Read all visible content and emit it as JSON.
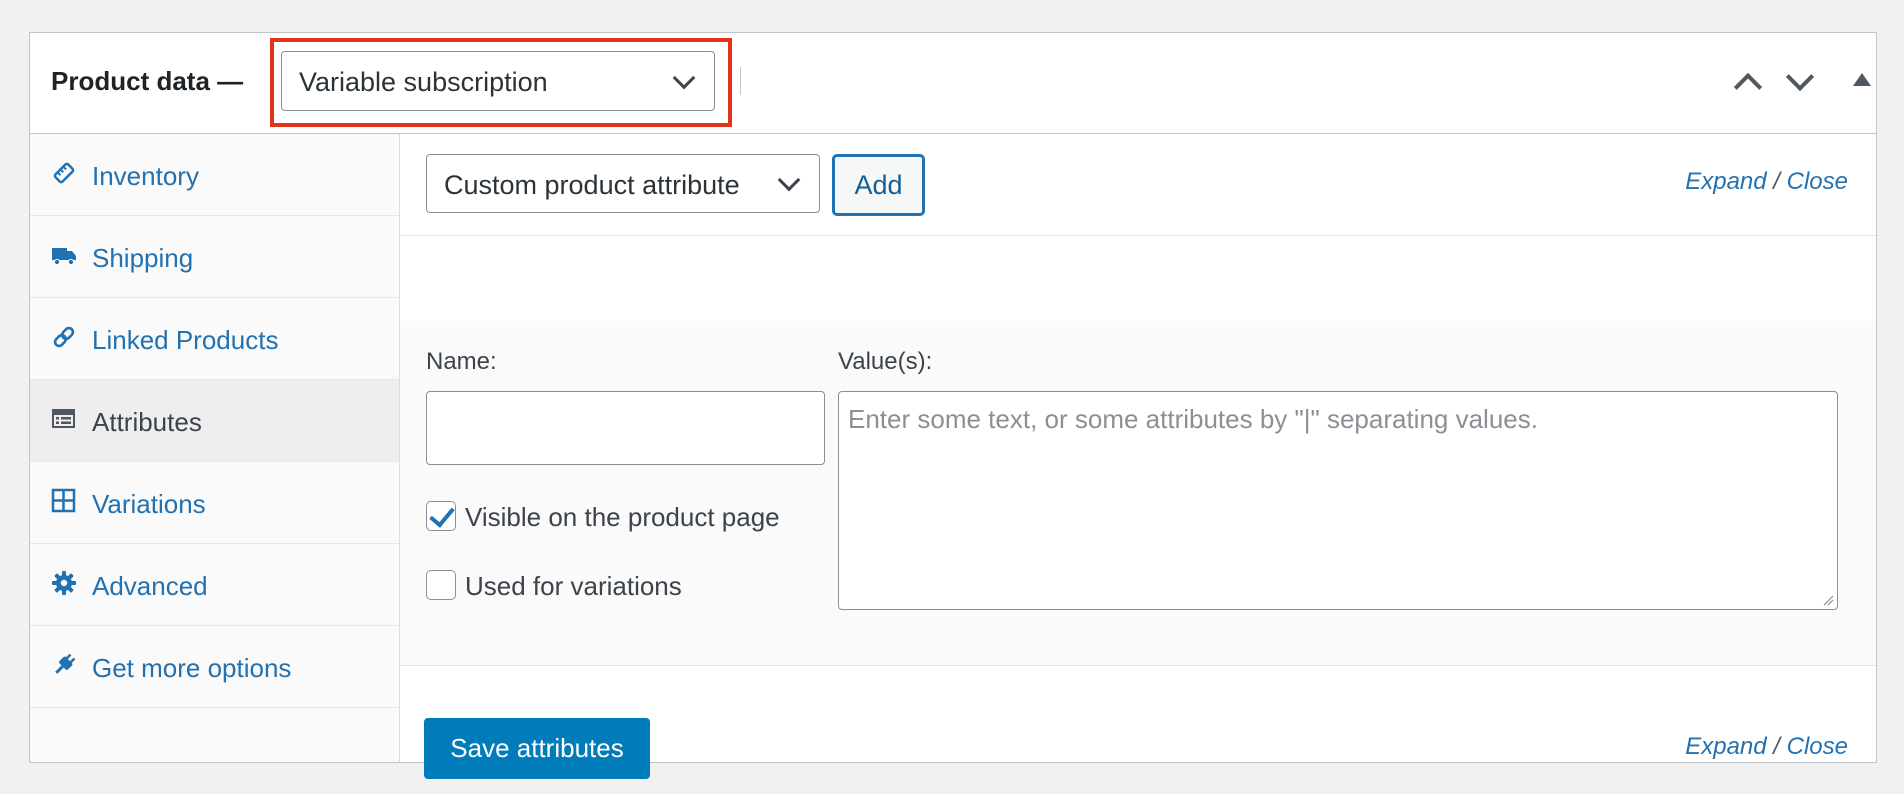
{
  "header": {
    "title": "Product data —",
    "product_type": "Variable subscription"
  },
  "sidebar": {
    "items": [
      {
        "label": "Inventory",
        "icon": "tag-icon"
      },
      {
        "label": "Shipping",
        "icon": "truck-icon"
      },
      {
        "label": "Linked Products",
        "icon": "link-icon"
      },
      {
        "label": "Attributes",
        "icon": "list-icon",
        "active": true
      },
      {
        "label": "Variations",
        "icon": "grid-icon"
      },
      {
        "label": "Advanced",
        "icon": "gear-icon"
      },
      {
        "label": "Get more options",
        "icon": "plugin-icon"
      }
    ]
  },
  "toolbar": {
    "attribute_select": "Custom product attribute",
    "add_label": "Add",
    "expand_label": "Expand",
    "slash": "/",
    "close_label": "Close"
  },
  "attribute": {
    "name_label": "Name:",
    "name_value": "",
    "values_label": "Value(s):",
    "values_placeholder": "Enter some text, or some attributes by \"|\" separating values.",
    "visible_label": "Visible on the product page",
    "visible_checked": true,
    "variations_label": "Used for variations",
    "variations_checked": false
  },
  "footer": {
    "save_label": "Save attributes",
    "expand_label": "Expand",
    "slash": "/",
    "close_label": "Close"
  },
  "colors": {
    "link": "#2271b1",
    "primary": "#007cba",
    "highlight": "#e4331b"
  }
}
